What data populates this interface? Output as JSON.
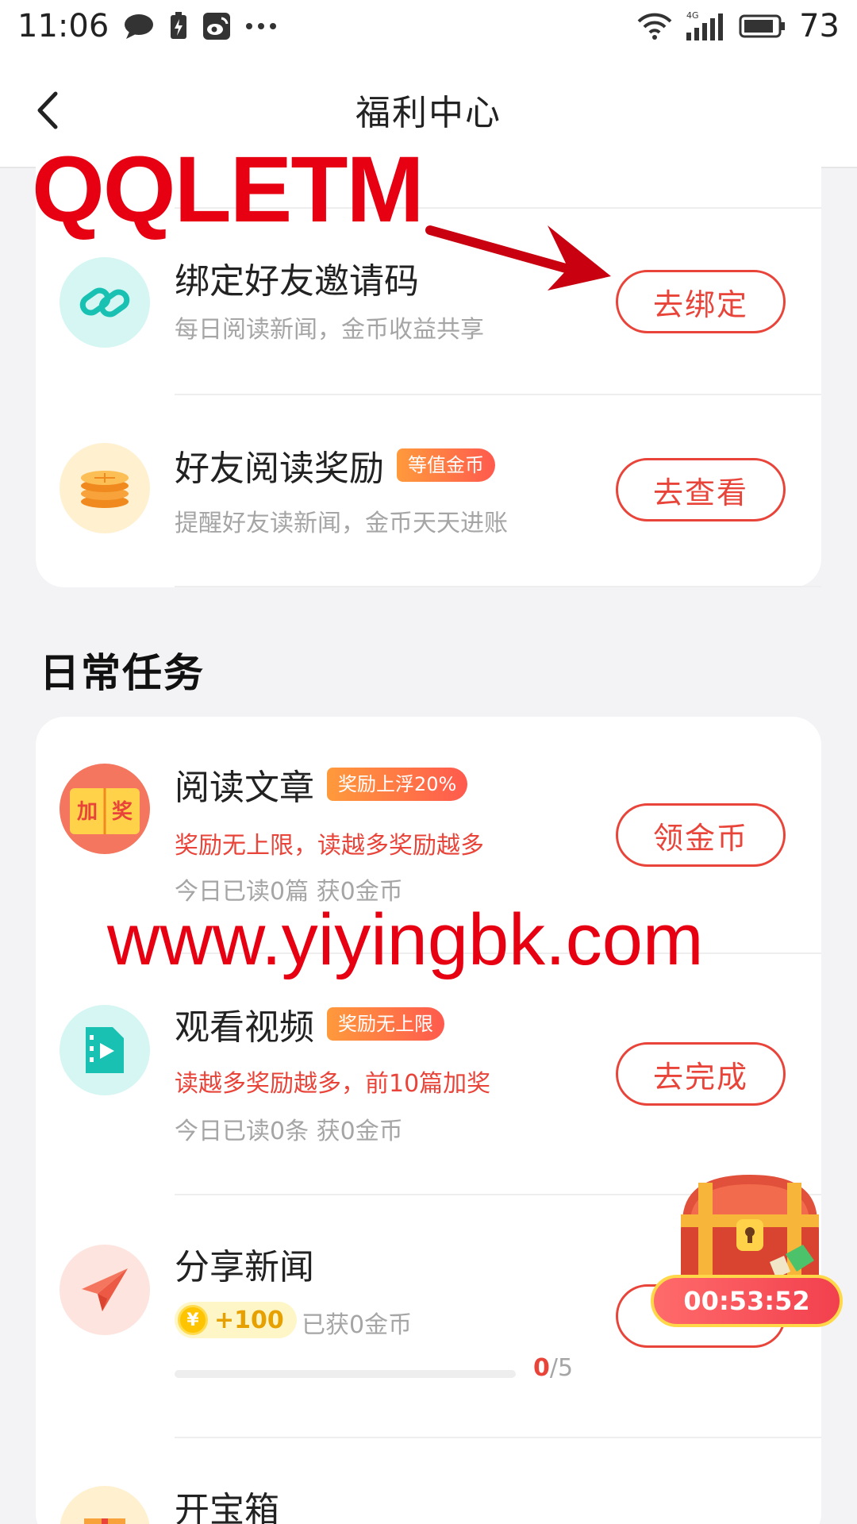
{
  "status_bar": {
    "time": "11:06",
    "battery": "73",
    "network": "4G"
  },
  "nav": {
    "title": "福利中心"
  },
  "watermarks": {
    "top": "QQLETM",
    "url": "www.yiyingbk.com"
  },
  "invite_tasks": [
    {
      "title": "绑定好友邀请码",
      "subtitle": "每日阅读新闻，金币收益共享",
      "button": "去绑定"
    },
    {
      "title": "好友阅读奖励",
      "tag": "等值金币",
      "subtitle": "提醒好友读新闻，金币天天进账",
      "button": "去查看"
    }
  ],
  "daily": {
    "section_title": "日常任务",
    "tasks": [
      {
        "title": "阅读文章",
        "tag": "奖励上浮20%",
        "subtitle_red": "奖励无上限，读越多奖励越多",
        "subtitle": "今日已读0篇   获0金币",
        "button": "领金币",
        "icon_text": "加奖"
      },
      {
        "title": "观看视频",
        "tag": "奖励无上限",
        "subtitle_red": "读越多奖励越多，前10篇加奖",
        "subtitle": "今日已读0条   获0金币",
        "button": "去完成"
      },
      {
        "title": "分享新闻",
        "reward": "+100",
        "reward_symbol": "¥",
        "earned": "已获0金币",
        "progress_current": "0",
        "progress_total": "/5",
        "progress_fraction": 0
      },
      {
        "title": "开宝箱"
      }
    ]
  },
  "treasure": {
    "timer": "00:53:52"
  },
  "colors": {
    "accent": "#e8443a",
    "watermark": "#e60012",
    "tag_gradient": [
      "#ff9a3c",
      "#ff5a4e"
    ]
  }
}
